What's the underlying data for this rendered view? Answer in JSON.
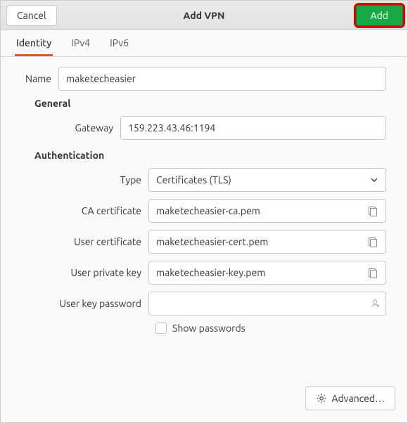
{
  "titlebar": {
    "cancel": "Cancel",
    "title": "Add VPN",
    "add": "Add"
  },
  "tabs": {
    "identity": "Identity",
    "ipv4": "IPv4",
    "ipv6": "IPv6"
  },
  "identity": {
    "name_label": "Name",
    "name_value": "maketecheasier",
    "general_heading": "General",
    "gateway_label": "Gateway",
    "gateway_value": "159.223.43.46:1194",
    "auth_heading": "Authentication",
    "type_label": "Type",
    "type_value": "Certificates (TLS)",
    "ca_label": "CA certificate",
    "ca_value": "maketecheasier-ca.pem",
    "usercert_label": "User certificate",
    "usercert_value": "maketecheasier-cert.pem",
    "userkey_label": "User private key",
    "userkey_value": "maketecheasier-key.pem",
    "userpw_label": "User key password",
    "userpw_value": "",
    "show_pw_label": "Show passwords"
  },
  "footer": {
    "advanced": "Advanced…"
  }
}
